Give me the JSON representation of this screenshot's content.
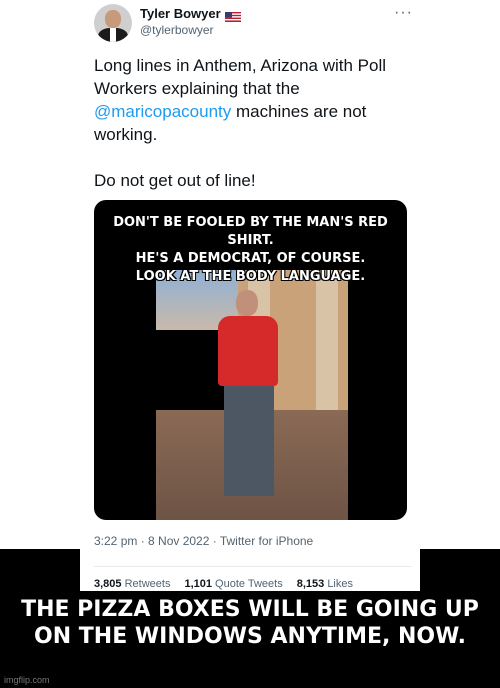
{
  "tweet": {
    "name": "Tyler Bowyer",
    "handle": "@tylerbowyer",
    "more": "···",
    "text_line1": "Long lines in Anthem, Arizona with Poll Workers explaining that the ",
    "mention": "@maricopacounty",
    "text_line1_end": " machines are not working.",
    "text_line2": "Do not get out of line!",
    "meta": "3:22 pm · 8 Nov 2022 · Twitter for iPhone",
    "stats": {
      "retweets_count": "3,805",
      "retweets_label": "Retweets",
      "quotes_count": "1,101",
      "quotes_label": "Quote Tweets",
      "likes_count": "8,153",
      "likes_label": "Likes"
    }
  },
  "meme": {
    "top_line1": "DON'T BE FOOLED BY THE MAN'S RED SHIRT.",
    "top_line2": "HE'S A DEMOCRAT, OF COURSE.",
    "top_line3": "LOOK AT THE BODY LANGUAGE.",
    "bottom_line1": "THE PIZZA BOXES WILL BE GOING UP",
    "bottom_line2": "ON THE WINDOWS ANYTIME, NOW."
  },
  "watermark": "imgflip.com",
  "icons": {
    "flag": "us-flag-icon",
    "more": "more-options-icon"
  },
  "colors": {
    "mention": "#1d9bf0",
    "shirt": "#d62a2a"
  }
}
